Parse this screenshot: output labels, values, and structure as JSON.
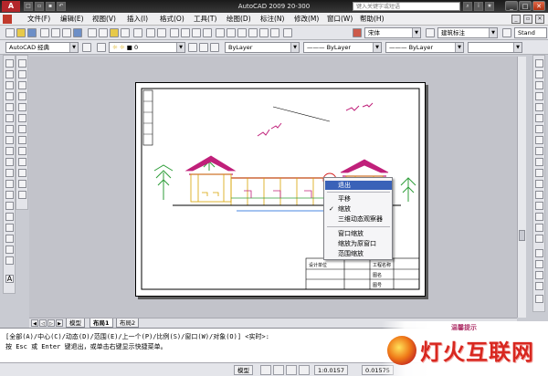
{
  "window": {
    "title": "AutoCAD 2009  20-300",
    "search_placeholder": "键入关键字或短语"
  },
  "menu": [
    "文件(F)",
    "编辑(E)",
    "视图(V)",
    "插入(I)",
    "格式(O)",
    "工具(T)",
    "绘图(D)",
    "标注(N)",
    "修改(M)",
    "窗口(W)",
    "帮助(H)"
  ],
  "toolbar": {
    "font_combo": "宋体",
    "style_combo": "建筑标注",
    "std_combo": "Stand",
    "workspace_combo": "AutoCAD 经典",
    "layer_combo": "ByLayer",
    "linetype_combo": "ByLayer",
    "lineweight_combo": "ByLayer"
  },
  "context_menu": {
    "items": [
      {
        "label": "退出",
        "selected": true,
        "checked": false
      },
      {
        "label": "平移",
        "selected": false,
        "checked": false
      },
      {
        "label": "缩放",
        "selected": false,
        "checked": true
      },
      {
        "label": "三维动态观察器",
        "selected": false,
        "checked": false
      },
      {
        "label": "窗口缩放",
        "selected": false,
        "checked": false
      },
      {
        "label": "缩放为原窗口",
        "selected": false,
        "checked": false
      },
      {
        "label": "范围缩放",
        "selected": false,
        "checked": false
      }
    ]
  },
  "title_block": {
    "label_design": "设计单位",
    "label_project": "工程名称",
    "label_drawing": "图名",
    "label_number": "图号"
  },
  "tabs": [
    "模型",
    "布局1",
    "布局2"
  ],
  "command": {
    "line1": "[全部(A)/中心(C)/动态(D)/范围(E)/上一个(P)/比例(S)/窗口(W)/对象(O)] <实时>:",
    "line2": "按 Esc 或 Enter 键退出，或单击右键显示快捷菜单。"
  },
  "status": {
    "model": "模型",
    "scale": "1:0.0157",
    "coords": "0.01575"
  },
  "watermark": {
    "tip": "温馨提示",
    "brand": "灯火互联网"
  },
  "colors": {
    "accent": "#3a62b8",
    "titlebar": "#1a1a1a",
    "drawing_magenta": "#c0207a",
    "drawing_yellow": "#d7a300",
    "drawing_green": "#2f9e3a"
  }
}
